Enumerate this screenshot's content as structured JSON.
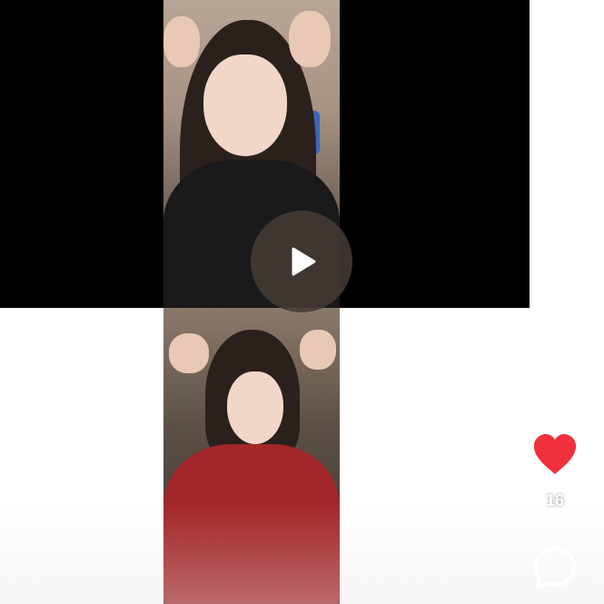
{
  "player": {
    "play_icon": "play-icon"
  },
  "actions": {
    "like_icon": "heart-icon",
    "like_color": "#f0303b",
    "like_count": "16",
    "comment_icon": "comment-bubble-icon"
  }
}
